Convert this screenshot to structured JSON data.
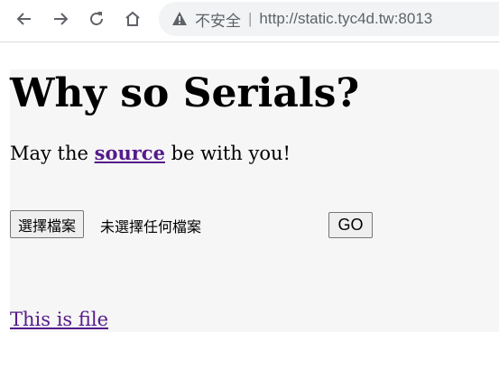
{
  "browser": {
    "security_label": "不安全",
    "divider": "|",
    "url": "http://static.tyc4d.tw:8013"
  },
  "page": {
    "title": "Why so Serials?",
    "tagline_before": "May the ",
    "tagline_link": "source",
    "tagline_after": " be with you!",
    "file_button_label": "選擇檔案",
    "no_file_text": "未選擇任何檔案",
    "go_button_label": "GO",
    "file_link_text": "This is file"
  },
  "colors": {
    "link_visited": "#551a8b",
    "page_background": "#f6f6f6"
  }
}
